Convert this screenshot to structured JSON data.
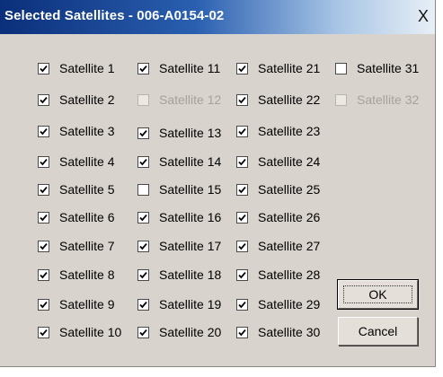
{
  "window": {
    "title": "Selected Satellites - 006-A0154-02",
    "close_label": "X"
  },
  "satellites": [
    {
      "label": "Satellite 1",
      "checked": true,
      "enabled": true
    },
    {
      "label": "Satellite 2",
      "checked": true,
      "enabled": true
    },
    {
      "label": "Satellite 3",
      "checked": true,
      "enabled": true
    },
    {
      "label": "Satellite 4",
      "checked": true,
      "enabled": true
    },
    {
      "label": "Satellite 5",
      "checked": true,
      "enabled": true
    },
    {
      "label": "Satellite 6",
      "checked": true,
      "enabled": true
    },
    {
      "label": "Satellite 7",
      "checked": true,
      "enabled": true
    },
    {
      "label": "Satellite 8",
      "checked": true,
      "enabled": true
    },
    {
      "label": "Satellite 9",
      "checked": true,
      "enabled": true
    },
    {
      "label": "Satellite 10",
      "checked": true,
      "enabled": true
    },
    {
      "label": "Satellite 11",
      "checked": true,
      "enabled": true
    },
    {
      "label": "Satellite 12",
      "checked": false,
      "enabled": false
    },
    {
      "label": "Satellite 13",
      "checked": true,
      "enabled": true
    },
    {
      "label": "Satellite 14",
      "checked": true,
      "enabled": true
    },
    {
      "label": "Satellite 15",
      "checked": false,
      "enabled": true
    },
    {
      "label": "Satellite 16",
      "checked": true,
      "enabled": true
    },
    {
      "label": "Satellite 17",
      "checked": true,
      "enabled": true
    },
    {
      "label": "Satellite 18",
      "checked": true,
      "enabled": true
    },
    {
      "label": "Satellite 19",
      "checked": true,
      "enabled": true
    },
    {
      "label": "Satellite 20",
      "checked": true,
      "enabled": true
    },
    {
      "label": "Satellite 21",
      "checked": true,
      "enabled": true
    },
    {
      "label": "Satellite 22",
      "checked": true,
      "enabled": true
    },
    {
      "label": "Satellite 23",
      "checked": true,
      "enabled": true
    },
    {
      "label": "Satellite 24",
      "checked": true,
      "enabled": true
    },
    {
      "label": "Satellite 25",
      "checked": true,
      "enabled": true
    },
    {
      "label": "Satellite 26",
      "checked": true,
      "enabled": true
    },
    {
      "label": "Satellite 27",
      "checked": true,
      "enabled": true
    },
    {
      "label": "Satellite 28",
      "checked": true,
      "enabled": true
    },
    {
      "label": "Satellite 29",
      "checked": true,
      "enabled": true
    },
    {
      "label": "Satellite 30",
      "checked": true,
      "enabled": true
    },
    {
      "label": "Satellite 31",
      "checked": false,
      "enabled": true
    },
    {
      "label": "Satellite 32",
      "checked": false,
      "enabled": false
    }
  ],
  "buttons": {
    "ok_label": "OK",
    "cancel_label": "Cancel"
  }
}
